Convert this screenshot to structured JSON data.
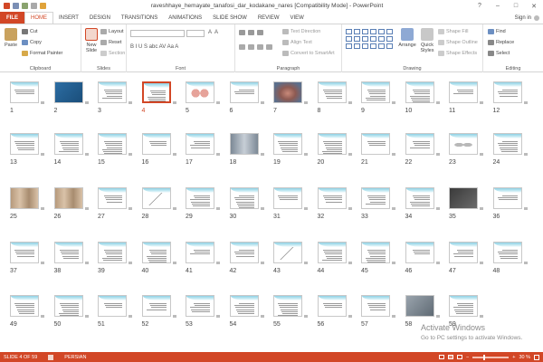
{
  "window": {
    "title": "raveshhaye_hemayate_tanafosi_dar_kodakane_nares [Compatibility Mode] - PowerPoint",
    "controls": [
      "?",
      "–",
      "□",
      "✕"
    ]
  },
  "qat": [
    "save",
    "undo",
    "redo",
    "slideshow"
  ],
  "tabs": [
    {
      "label": "FILE",
      "type": "file"
    },
    {
      "label": "HOME",
      "type": "active"
    },
    {
      "label": "INSERT",
      "type": ""
    },
    {
      "label": "DESIGN",
      "type": ""
    },
    {
      "label": "TRANSITIONS",
      "type": ""
    },
    {
      "label": "ANIMATIONS",
      "type": ""
    },
    {
      "label": "SLIDE SHOW",
      "type": ""
    },
    {
      "label": "REVIEW",
      "type": ""
    },
    {
      "label": "VIEW",
      "type": ""
    }
  ],
  "signin": "Sign in",
  "ribbon": {
    "clipboard": {
      "label": "Clipboard",
      "paste": "Paste",
      "cut": "Cut",
      "copy": "Copy",
      "format_painter": "Format Painter"
    },
    "slides": {
      "label": "Slides",
      "new_slide": "New Slide",
      "layout": "Layout",
      "reset": "Reset",
      "section": "Section"
    },
    "font": {
      "label": "Font",
      "buttons": "B I U S abc AV Aa A"
    },
    "paragraph": {
      "label": "Paragraph",
      "text_direction": "Text Direction",
      "align_text": "Align Text",
      "smartart": "Convert to SmartArt"
    },
    "drawing": {
      "label": "Drawing",
      "arrange": "Arrange",
      "quick_styles": "Quick Styles",
      "shape_fill": "Shape Fill",
      "shape_outline": "Shape Outline",
      "shape_effects": "Shape Effects"
    },
    "editing": {
      "label": "Editing",
      "find": "Find",
      "replace": "Replace",
      "select": "Select"
    }
  },
  "slides": [
    {
      "n": "1",
      "t": "text"
    },
    {
      "n": "2",
      "t": "blue"
    },
    {
      "n": "3",
      "t": "text"
    },
    {
      "n": "4",
      "t": "text",
      "sel": true
    },
    {
      "n": "5",
      "t": "hands"
    },
    {
      "n": "6",
      "t": "text"
    },
    {
      "n": "7",
      "t": "photo"
    },
    {
      "n": "8",
      "t": "text"
    },
    {
      "n": "9",
      "t": "text"
    },
    {
      "n": "10",
      "t": "text"
    },
    {
      "n": "11",
      "t": "text"
    },
    {
      "n": "12",
      "t": "text"
    },
    {
      "n": "13",
      "t": "text"
    },
    {
      "n": "14",
      "t": "text"
    },
    {
      "n": "15",
      "t": "text"
    },
    {
      "n": "16",
      "t": "text"
    },
    {
      "n": "17",
      "t": "text"
    },
    {
      "n": "18",
      "t": "xray"
    },
    {
      "n": "19",
      "t": "text"
    },
    {
      "n": "20",
      "t": "text"
    },
    {
      "n": "21",
      "t": "text"
    },
    {
      "n": "22",
      "t": "text"
    },
    {
      "n": "23",
      "t": "ovals"
    },
    {
      "n": "24",
      "t": "text"
    },
    {
      "n": "25",
      "t": "babies"
    },
    {
      "n": "26",
      "t": "babies"
    },
    {
      "n": "27",
      "t": "text"
    },
    {
      "n": "28",
      "t": "sketch"
    },
    {
      "n": "29",
      "t": "text"
    },
    {
      "n": "30",
      "t": "text"
    },
    {
      "n": "31",
      "t": "text"
    },
    {
      "n": "32",
      "t": "text"
    },
    {
      "n": "33",
      "t": "text"
    },
    {
      "n": "34",
      "t": "text"
    },
    {
      "n": "35",
      "t": "dark"
    },
    {
      "n": "36",
      "t": "text"
    },
    {
      "n": "37",
      "t": "text"
    },
    {
      "n": "38",
      "t": "text"
    },
    {
      "n": "39",
      "t": "text"
    },
    {
      "n": "40",
      "t": "text"
    },
    {
      "n": "41",
      "t": "text"
    },
    {
      "n": "42",
      "t": "text"
    },
    {
      "n": "43",
      "t": "sketch"
    },
    {
      "n": "44",
      "t": "text"
    },
    {
      "n": "45",
      "t": "text"
    },
    {
      "n": "46",
      "t": "text"
    },
    {
      "n": "47",
      "t": "text"
    },
    {
      "n": "48",
      "t": "text"
    },
    {
      "n": "49",
      "t": "text"
    },
    {
      "n": "50",
      "t": "text"
    },
    {
      "n": "51",
      "t": "text"
    },
    {
      "n": "52",
      "t": "text"
    },
    {
      "n": "53",
      "t": "text"
    },
    {
      "n": "54",
      "t": "text"
    },
    {
      "n": "55",
      "t": "text"
    },
    {
      "n": "56",
      "t": "text"
    },
    {
      "n": "57",
      "t": "text"
    },
    {
      "n": "58",
      "t": "photo2"
    },
    {
      "n": "59",
      "t": "text"
    }
  ],
  "watermark": {
    "line1": "Activate Windows",
    "line2": "Go to PC settings to activate Windows."
  },
  "status": {
    "slide": "SLIDE 4 OF 59",
    "lang": "PERSIAN",
    "zoom": "30 %",
    "zoom_level": 0.3
  },
  "colors": {
    "accent": "#d24726",
    "wave": "#8fd0e4"
  }
}
